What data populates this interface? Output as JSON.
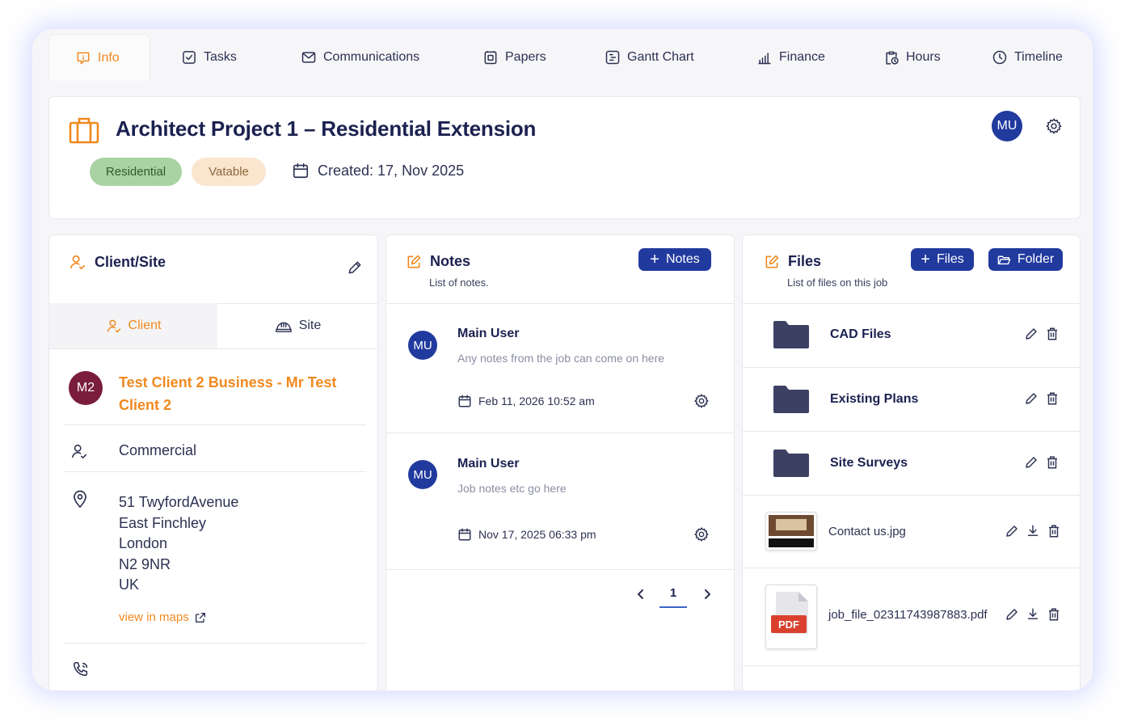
{
  "tabs": [
    {
      "label": "Info",
      "icon": "info-chat-icon"
    },
    {
      "label": "Tasks",
      "icon": "checkbox-icon"
    },
    {
      "label": "Communications",
      "icon": "mail-icon"
    },
    {
      "label": "Papers",
      "icon": "papers-icon"
    },
    {
      "label": "Gantt Chart",
      "icon": "gantt-icon"
    },
    {
      "label": "Finance",
      "icon": "bar-chart-icon"
    },
    {
      "label": "Hours",
      "icon": "clipboard-clock-icon"
    },
    {
      "label": "Timeline",
      "icon": "clock-icon"
    }
  ],
  "project": {
    "title": "Architect Project 1 – Residential Extension",
    "tags": [
      "Residential",
      "Vatable"
    ],
    "created": "Created: 17, Nov 2025",
    "user_initials": "MU"
  },
  "client_site": {
    "title": "Client/Site",
    "tabs": [
      "Client",
      "Site"
    ],
    "client_initials": "M2",
    "client_name": "Test Client 2 Business - Mr Test Client 2",
    "type": "Commercial",
    "address": [
      "51 TwyfordAvenue",
      "East Finchley",
      "London",
      "N2 9NR",
      "UK"
    ],
    "maps_link": "view in maps"
  },
  "notes": {
    "title": "Notes",
    "subtitle": "List of notes.",
    "add_label": "Notes",
    "items": [
      {
        "initials": "MU",
        "user": "Main User",
        "text": "Any notes from the job can come on here",
        "date": "Feb 11, 2026 10:52 am"
      },
      {
        "initials": "MU",
        "user": "Main User",
        "text": "Job notes etc go here",
        "date": "Nov 17, 2025 06:33 pm"
      }
    ],
    "page": "1"
  },
  "files": {
    "title": "Files",
    "subtitle": "List of files on this job",
    "add_files_label": "Files",
    "add_folder_label": "Folder",
    "folders": [
      "CAD Files",
      "Existing Plans",
      "Site Surveys"
    ],
    "documents": [
      {
        "name": "Contact us.jpg",
        "kind": "image"
      },
      {
        "name": "job_file_02311743987883.pdf",
        "kind": "pdf",
        "badge": "PDF"
      }
    ]
  },
  "colors": {
    "accent": "#f0891f",
    "primary": "#213a9e",
    "title": "#1b2150",
    "residential_tag": "#a9d3a3",
    "vatable_tag": "#fbe5cf",
    "folder": "#3c4164"
  }
}
